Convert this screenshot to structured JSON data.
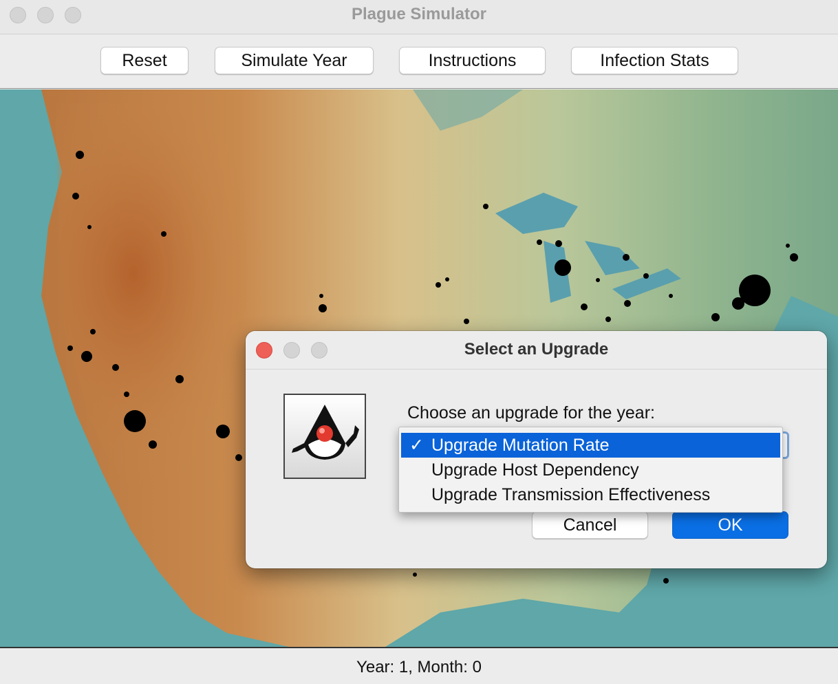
{
  "window": {
    "title": "Plague Simulator"
  },
  "toolbar": {
    "buttons": [
      {
        "label": "Reset"
      },
      {
        "label": "Simulate Year"
      },
      {
        "label": "Instructions"
      },
      {
        "label": "Infection Stats"
      }
    ]
  },
  "status": {
    "text": "Year: 1, Month: 0"
  },
  "dialog": {
    "title": "Select an Upgrade",
    "prompt": "Choose an upgrade for the year:",
    "options": [
      {
        "label": "Upgrade Mutation Rate",
        "selected": true,
        "check": "✓"
      },
      {
        "label": "Upgrade Host Dependency",
        "selected": false
      },
      {
        "label": "Upgrade Transmission Effectiveness",
        "selected": false
      }
    ],
    "cancel_label": "Cancel",
    "ok_label": "OK"
  },
  "colors": {
    "accent": "#0a6fe4",
    "close_red": "#ee5f57",
    "ocean": "#5fa7a9",
    "infection_dot": "#000000"
  },
  "icons": {
    "app_icon": "java-duke-icon",
    "check": "checkmark-icon"
  }
}
